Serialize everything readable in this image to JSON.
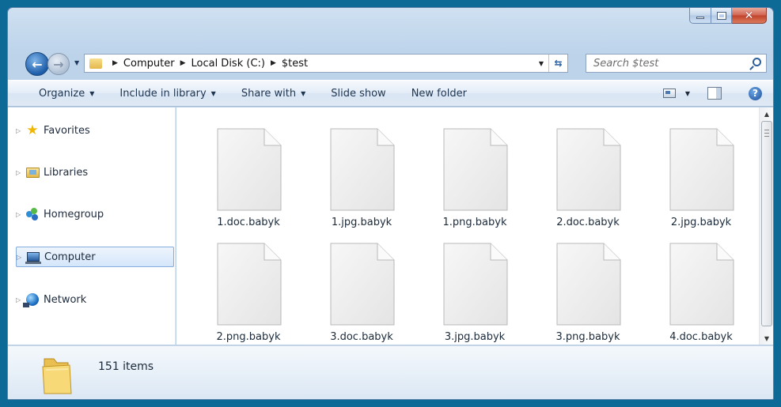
{
  "window": {
    "caption_buttons": {
      "minimize": "minimize",
      "maximize": "maximize",
      "close": "close"
    }
  },
  "nav": {
    "address": {
      "crumbs": [
        "Computer",
        "Local Disk (C:)",
        "$test"
      ]
    },
    "search": {
      "placeholder": "Search $test"
    }
  },
  "commandbar": {
    "organize": "Organize",
    "include_in_library": "Include in library",
    "share_with": "Share with",
    "slide_show": "Slide show",
    "new_folder": "New folder"
  },
  "sidebar": {
    "items": [
      {
        "label": "Favorites",
        "icon": "star-icon"
      },
      {
        "label": "Libraries",
        "icon": "libraries-icon"
      },
      {
        "label": "Homegroup",
        "icon": "homegroup-icon"
      },
      {
        "label": "Computer",
        "icon": "computer-icon",
        "selected": true
      },
      {
        "label": "Network",
        "icon": "network-icon"
      }
    ]
  },
  "files": [
    {
      "name": "1.doc.babyk"
    },
    {
      "name": "1.jpg.babyk"
    },
    {
      "name": "1.png.babyk"
    },
    {
      "name": "2.doc.babyk"
    },
    {
      "name": "2.jpg.babyk"
    },
    {
      "name": "2.png.babyk"
    },
    {
      "name": "3.doc.babyk"
    },
    {
      "name": "3.jpg.babyk"
    },
    {
      "name": "3.png.babyk"
    },
    {
      "name": "4.doc.babyk"
    }
  ],
  "details": {
    "item_count": "151 items"
  },
  "colors": {
    "desktop": "#0d6a96",
    "window_frame": "#bcd3ea",
    "selection": "#d4e6fa"
  }
}
